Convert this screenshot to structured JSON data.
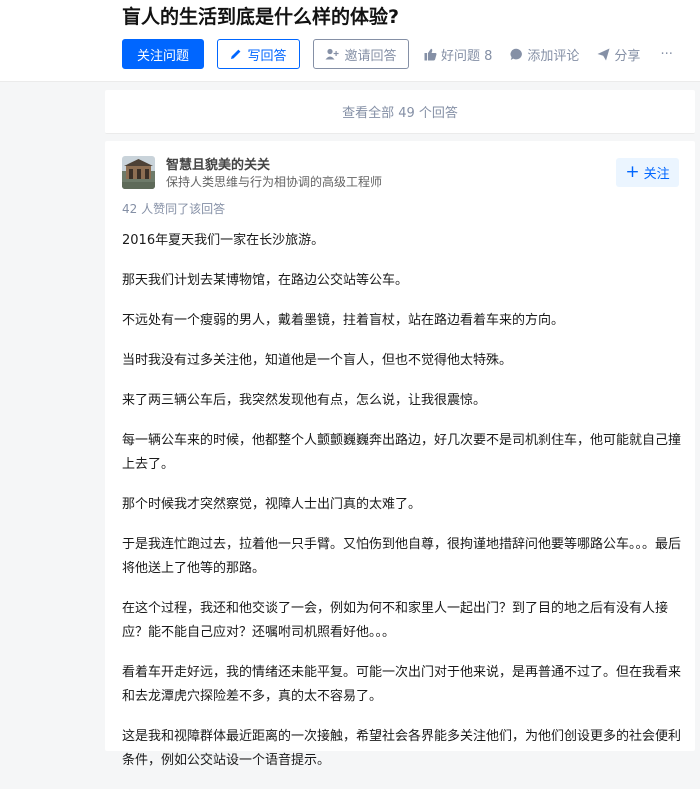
{
  "question": {
    "title": "盲人的生活到底是什么样的体验?",
    "buttons": {
      "follow": "关注问题",
      "write": "写回答",
      "invite": "邀请回答"
    },
    "meta": {
      "good_question": "好问题 8",
      "comment": "添加评论",
      "share": "分享",
      "more": "···"
    }
  },
  "view_all": "查看全部 49 个回答",
  "answer": {
    "author": {
      "name": "智慧且貌美的关关",
      "bio": "保持人类思维与行为相协调的高级工程师",
      "follow_label": "关注"
    },
    "votes_text": "42 人赞同了该回答",
    "paragraphs": [
      "2016年夏天我们一家在长沙旅游。",
      "那天我们计划去某博物馆，在路边公交站等公车。",
      "不远处有一个瘦弱的男人，戴着墨镜，拄着盲杖，站在路边看着车来的方向。",
      "当时我没有过多关注他，知道他是一个盲人，但也不觉得他太特殊。",
      "来了两三辆公车后，我突然发现他有点，怎么说，让我很震惊。",
      "每一辆公车来的时候，他都整个人颤颤巍巍奔出路边，好几次要不是司机刹住车，他可能就自己撞上去了。",
      "那个时候我才突然察觉，视障人士出门真的太难了。",
      "于是我连忙跑过去，拉着他一只手臂。又怕伤到他自尊，很拘谨地措辞问他要等哪路公车。。。最后将他送上了他等的那路。",
      "在这个过程，我还和他交谈了一会，例如为何不和家里人一起出门？到了目的地之后有没有人接应？能不能自己应对？还嘱咐司机照看好他。。。",
      "看着车开走好远，我的情绪还未能平复。可能一次出门对于他来说，是再普通不过了。但在我看来和去龙潭虎穴探险差不多，真的太不容易了。",
      "这是我和视障群体最近距离的一次接触，希望社会各界能多关注他们，为他们创设更多的社会便利条件，例如公交站设一个语音提示。"
    ]
  },
  "colors": {
    "brand_blue": "#0066ff",
    "muted_gray": "#8590a6",
    "page_bg": "#f5f6f7"
  }
}
